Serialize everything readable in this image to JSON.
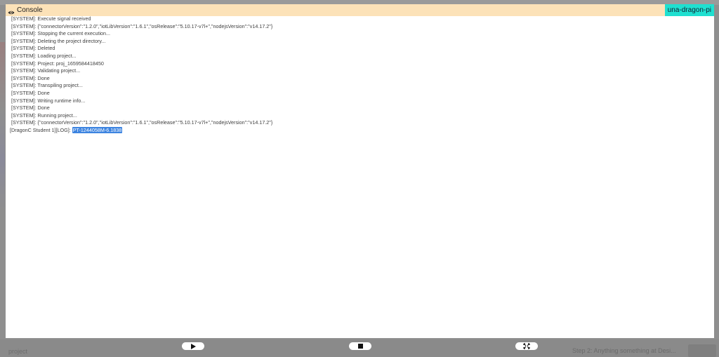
{
  "console": {
    "title": "Console",
    "device": "una-dragon-pi",
    "lines": [
      "[SYSTEM]: Execute signal received",
      "[SYSTEM]: {\"connectorVersion\":\"1.2.0\",\"iotLibVersion\":\"1.6.1\",\"osRelease\":\"5.10.17-v7l+\",\"nodejsVersion\":\"v14.17.2\"}",
      "[SYSTEM]: Stopping the current execution...",
      "[SYSTEM]: Deleting the project directory...",
      "[SYSTEM]: Deleted",
      "[SYSTEM]: Loading project...",
      "[SYSTEM]: Project: proj_1659584418450",
      "[SYSTEM]: Validating project...",
      "[SYSTEM]: Done",
      "[SYSTEM]: Transpiling project...",
      "[SYSTEM]: Done",
      "[SYSTEM]: Writing runtime info...",
      "[SYSTEM]: Done",
      "[SYSTEM]: Running project...",
      "[SYSTEM]: {\"connectorVersion\":\"1.2.0\",\"iotLibVersion\":\"1.6.1\",\"osRelease\":\"5.10.17-v7l+\",\"nodejsVersion\":\"v14.17.2\"}"
    ],
    "user_log_prefix": "[DragonC Student 1][LOG]:",
    "user_log_value": "PT-1244058M-6.1838"
  },
  "controls": {
    "play": "play-icon",
    "stop": "stop-icon",
    "fullscreen": "fullscreen-icon"
  },
  "background": {
    "bottom_left": "project",
    "bottom_right": "Step 2: Anything something at Desi..."
  }
}
